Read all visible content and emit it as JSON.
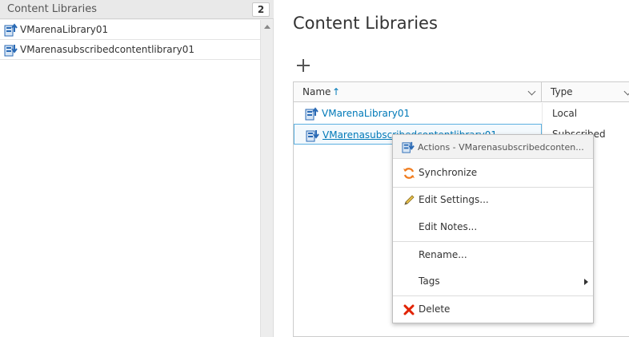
{
  "sidebar": {
    "title": "Content Libraries",
    "count": "2",
    "items": [
      {
        "label": "VMarenaLibrary01",
        "icon": "local-library-icon"
      },
      {
        "label": "VMarenasubscribedcontentlibrary01",
        "icon": "subscribed-library-icon"
      }
    ]
  },
  "main": {
    "title": "Content Libraries",
    "add_icon": "plus-icon",
    "grid": {
      "columns": [
        {
          "label": "Name",
          "sort": "↑"
        },
        {
          "label": "Type"
        }
      ],
      "rows": [
        {
          "name": "VMarenaLibrary01",
          "type": "Local",
          "icon": "local-library-icon"
        },
        {
          "name": "VMarenasubscribedcontentlibrary01",
          "type": "Subscribed",
          "icon": "subscribed-library-icon",
          "selected": true
        }
      ]
    }
  },
  "context_menu": {
    "header": "Actions - VMarenasubscribedconten...",
    "items": [
      {
        "label": "Synchronize",
        "icon": "sync-icon"
      },
      {
        "label": "Edit Settings...",
        "icon": "pencil-icon"
      },
      {
        "label": "Edit Notes..."
      },
      {
        "label": "Rename..."
      },
      {
        "label": "Tags",
        "has_submenu": true
      },
      {
        "label": "Delete",
        "icon": "delete-icon"
      }
    ]
  },
  "colors": {
    "link": "#0079b8",
    "selection_border": "#5cb0e0",
    "sync_icon": "#f07c1e",
    "delete_icon": "#e12200",
    "library_icon": "#2a6ab5"
  }
}
